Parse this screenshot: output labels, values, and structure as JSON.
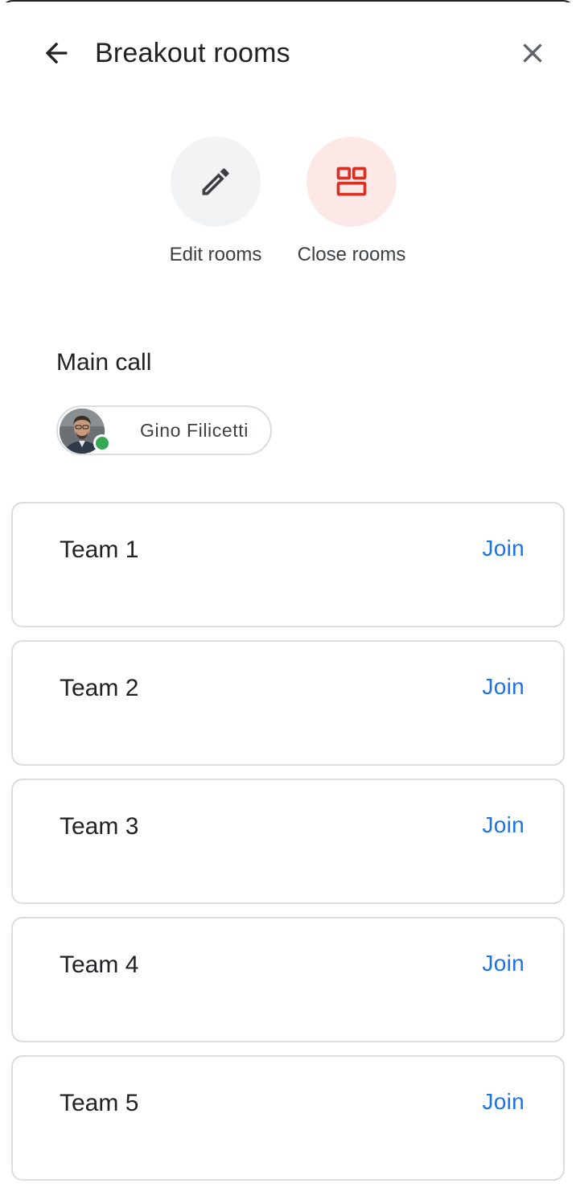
{
  "header": {
    "title": "Breakout rooms",
    "back_icon": "arrow-back-icon",
    "close_icon": "close-icon"
  },
  "actions": {
    "edit": {
      "label": "Edit rooms",
      "icon": "pencil-icon"
    },
    "close": {
      "label": "Close rooms",
      "icon": "grid-icon",
      "icon_color": "#d93025"
    }
  },
  "main_call": {
    "label": "Main call",
    "participants": [
      {
        "name": "Gino Filicetti",
        "status": "online",
        "status_color": "#34a853"
      }
    ]
  },
  "rooms": [
    {
      "name": "Team 1",
      "join_label": "Join"
    },
    {
      "name": "Team 2",
      "join_label": "Join"
    },
    {
      "name": "Team 3",
      "join_label": "Join"
    },
    {
      "name": "Team 4",
      "join_label": "Join"
    },
    {
      "name": "Team 5",
      "join_label": "Join"
    }
  ],
  "colors": {
    "accent": "#1a73e8",
    "danger": "#d93025",
    "online": "#34a853"
  }
}
